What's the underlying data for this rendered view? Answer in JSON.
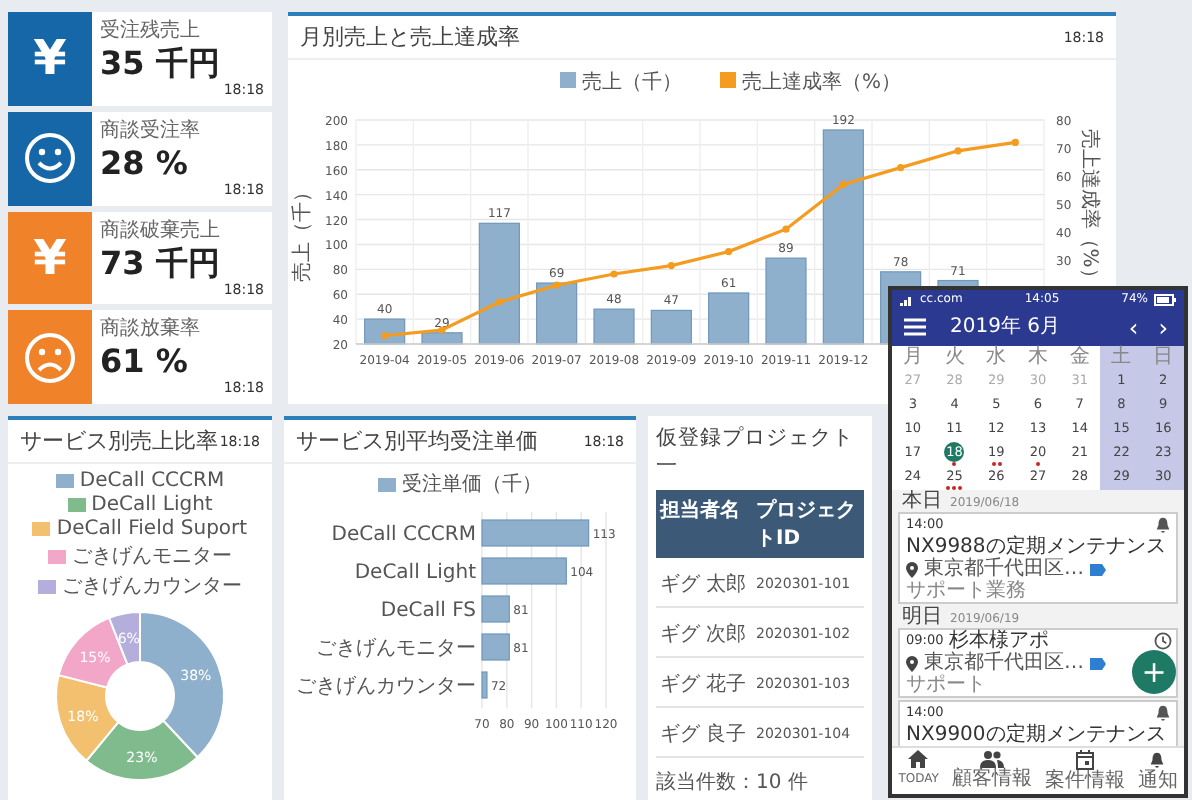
{
  "kpis": [
    {
      "kind": "text",
      "icon_text": "¥",
      "color": "#1667a8",
      "label": "受注残売上",
      "value": "35 千円",
      "time": "18:18"
    },
    {
      "kind": "smile",
      "color": "#1667a8",
      "label": "商談受注率",
      "value": "28 %",
      "time": "18:18"
    },
    {
      "kind": "text",
      "icon_text": "¥",
      "color": "#f0822a",
      "label": "商談破棄売上",
      "value": "73 千円",
      "time": "18:18"
    },
    {
      "kind": "frown",
      "color": "#f0822a",
      "label": "商談放棄率",
      "value": "61 %",
      "time": "18:18"
    }
  ],
  "sales_chart": {
    "title": "月別売上と売上達成率",
    "time": "18:18",
    "chart_data": {
      "type": "bar",
      "categories": [
        "2019-04",
        "2019-05",
        "2019-06",
        "2019-07",
        "2019-08",
        "2019-09",
        "2019-10",
        "2019-11",
        "2019-12",
        null,
        null,
        null
      ],
      "series": [
        {
          "name": "売上（千）",
          "color": "#8fb0cc",
          "values": [
            40,
            29,
            117,
            69,
            48,
            47,
            61,
            89,
            192,
            78,
            71,
            null
          ]
        }
      ],
      "ylabel": "売上（千）",
      "ylim": [
        20,
        200
      ],
      "yticks": [
        20,
        40,
        60,
        80,
        100,
        120,
        140,
        160,
        180,
        200
      ],
      "data_labels": true,
      "grid": true
    },
    "rate_chart": {
      "chart_data": {
        "type": "line",
        "series": [
          {
            "name": "売上達成率（%）",
            "color": "#f39c1f",
            "marker": true,
            "values": [
              3,
              5,
              15,
              21,
              25,
              28,
              33,
              41,
              57,
              63,
              69,
              72
            ]
          }
        ],
        "ylabel": "売上達成率（%）",
        "ylim": [
          0,
          80
        ],
        "yticks": [
          30,
          40,
          50,
          60,
          70,
          80
        ]
      }
    }
  },
  "share_chart": {
    "title": "サービス別売上比率",
    "time": "18:18",
    "chart_data": {
      "type": "donut",
      "categories": [
        "DeCall CCCRM",
        "DeCall Light",
        "DeCall Field Suport",
        "ごきげんモニター",
        "ごきげんカウンター"
      ],
      "values": [
        38,
        23,
        18,
        15,
        6
      ],
      "colors": [
        "#8fb0cc",
        "#80bb8e",
        "#f2c06e",
        "#f2a7c9",
        "#b3aedc"
      ],
      "value_labels": [
        "38%",
        "23%",
        "18%",
        "15%",
        "6%"
      ]
    }
  },
  "price_chart": {
    "title": "サービス別平均受注単価",
    "time": "18:18",
    "chart_data": {
      "type": "bar",
      "orientation": "horizontal",
      "categories": [
        "DeCall CCCRM",
        "DeCall Light",
        "DeCall FS",
        "ごきげんモニター",
        "ごきげんカウンター"
      ],
      "series": [
        {
          "name": "受注単価（千）",
          "color": "#8fb0cc",
          "values": [
            113,
            104,
            81,
            81,
            72
          ]
        }
      ],
      "xlim": [
        70,
        120
      ],
      "xticks": [
        70,
        80,
        90,
        100,
        110,
        120
      ],
      "data_labels": true,
      "grid": true
    }
  },
  "projects": {
    "title": "仮登録プロジェクト一",
    "columns": [
      "担当者名",
      "プロジェクトID"
    ],
    "rows": [
      [
        "ギグ 太郎",
        "2020301-101"
      ],
      [
        "ギグ 次郎",
        "2020301-102"
      ],
      [
        "ギグ 花子",
        "2020301-103"
      ],
      [
        "ギグ 良子",
        "2020301-104"
      ]
    ],
    "count": "該当件数：10 件"
  },
  "phone": {
    "status": {
      "carrier": "cc.com",
      "time": "14:05",
      "battery": "74%"
    },
    "month": "2019年 6月",
    "prev": "‹",
    "next": "›",
    "weekdays": [
      {
        "label": "月",
        "weekend": false
      },
      {
        "label": "火",
        "weekend": false
      },
      {
        "label": "水",
        "weekend": false
      },
      {
        "label": "木",
        "weekend": false
      },
      {
        "label": "金",
        "weekend": false
      },
      {
        "label": "土",
        "weekend": true
      },
      {
        "label": "日",
        "weekend": true
      }
    ],
    "weeks": [
      [
        {
          "day": "27",
          "muted": true,
          "selected": false
        },
        {
          "day": "28",
          "muted": true,
          "selected": false
        },
        {
          "day": "29",
          "muted": true,
          "selected": false
        },
        {
          "day": "30",
          "muted": true,
          "selected": false
        },
        {
          "day": "31",
          "muted": true,
          "selected": false
        },
        {
          "day": "1",
          "muted": false,
          "selected": false
        },
        {
          "day": "2",
          "muted": false,
          "selected": false
        }
      ],
      [
        {
          "day": "3",
          "muted": false,
          "selected": false
        },
        {
          "day": "4",
          "muted": false,
          "selected": false
        },
        {
          "day": "5",
          "muted": false,
          "selected": false
        },
        {
          "day": "6",
          "muted": false,
          "selected": false
        },
        {
          "day": "7",
          "muted": false,
          "selected": false
        },
        {
          "day": "8",
          "muted": false,
          "selected": false
        },
        {
          "day": "9",
          "muted": false,
          "selected": false
        }
      ],
      [
        {
          "day": "10",
          "muted": false,
          "selected": false
        },
        {
          "day": "11",
          "muted": false,
          "selected": false
        },
        {
          "day": "12",
          "muted": false,
          "selected": false
        },
        {
          "day": "13",
          "muted": false,
          "selected": false
        },
        {
          "day": "14",
          "muted": false,
          "selected": false
        },
        {
          "day": "15",
          "muted": false,
          "selected": false
        },
        {
          "day": "16",
          "muted": false,
          "selected": false
        }
      ],
      [
        {
          "day": "17",
          "muted": false,
          "selected": false
        },
        {
          "day": "18",
          "muted": false,
          "selected": true,
          "dots": [
            {
              "color": "#c62828"
            }
          ]
        },
        {
          "day": "19",
          "muted": false,
          "selected": false,
          "dots": [
            {
              "color": "#c62828"
            },
            {
              "color": "#c62828"
            }
          ]
        },
        {
          "day": "20",
          "muted": false,
          "selected": false,
          "dots": [
            {
              "color": "#c62828"
            }
          ]
        },
        {
          "day": "21",
          "muted": false,
          "selected": false
        },
        {
          "day": "22",
          "muted": false,
          "selected": false
        },
        {
          "day": "23",
          "muted": false,
          "selected": false
        }
      ],
      [
        {
          "day": "24",
          "muted": false,
          "selected": false
        },
        {
          "day": "25",
          "muted": false,
          "selected": false,
          "dots": [
            {
              "color": "#c62828"
            },
            {
              "color": "#c62828"
            },
            {
              "color": "#c62828"
            }
          ]
        },
        {
          "day": "26",
          "muted": false,
          "selected": false
        },
        {
          "day": "27",
          "muted": false,
          "selected": false
        },
        {
          "day": "28",
          "muted": false,
          "selected": false
        },
        {
          "day": "29",
          "muted": false,
          "selected": false
        },
        {
          "day": "30",
          "muted": false,
          "selected": false
        }
      ]
    ],
    "sections": [
      {
        "label": "本日",
        "date": "2019/06/18",
        "events": [
          {
            "kind": "alert",
            "time": "14:00",
            "title": "NX9988の定期メンテナンス",
            "place": "東京都千代田区…",
            "tag": "サポート業務"
          }
        ]
      },
      {
        "label": "明日",
        "date": "2019/06/19",
        "events": [
          {
            "kind": "timed",
            "time": "09:00",
            "title": "杉本様アポ",
            "place": "東京都千代田区…",
            "tag": "サポート"
          },
          {
            "kind": "alert",
            "time": "14:00",
            "title": "NX9900の定期メンテナンス"
          }
        ]
      }
    ],
    "fab": "+",
    "nav": [
      {
        "kind": "home",
        "label": "TODAY"
      },
      {
        "kind": "people",
        "label": "顧客情報"
      },
      {
        "kind": "calendar",
        "label": "案件情報"
      },
      {
        "kind": "bell",
        "label": "通知"
      }
    ]
  }
}
